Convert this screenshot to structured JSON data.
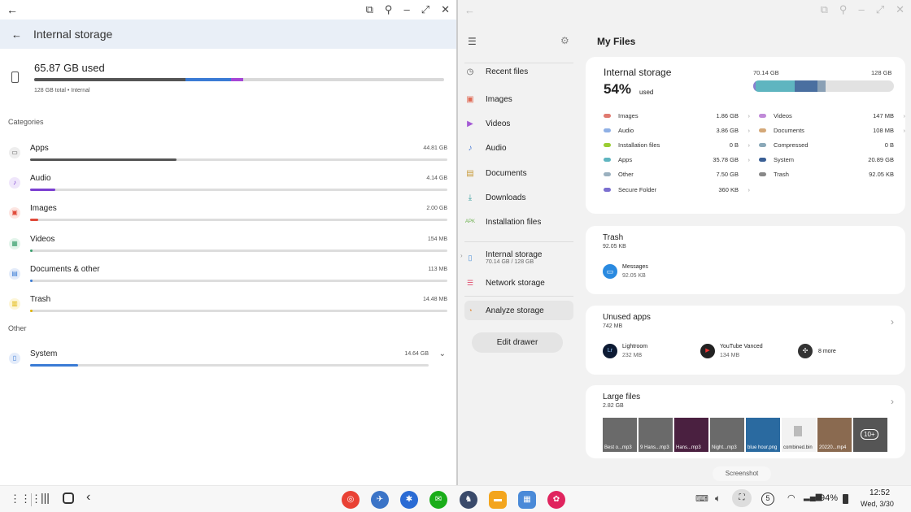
{
  "left": {
    "header_title": "Internal storage",
    "used": "65.87 GB used",
    "total": "128 GB total • Internal",
    "categories_label": "Categories",
    "other_label": "Other",
    "categories": [
      {
        "name": "Apps",
        "size": "44.81 GB",
        "fraction": 0.35,
        "color": "#555555"
      },
      {
        "name": "Audio",
        "size": "4.14 GB",
        "fraction": 0.06,
        "color": "#7b3fd1"
      },
      {
        "name": "Images",
        "size": "2.00 GB",
        "fraction": 0.02,
        "color": "#e04a3a"
      },
      {
        "name": "Videos",
        "size": "154 MB",
        "fraction": 0.004,
        "color": "#3aa06e"
      },
      {
        "name": "Documents & other",
        "size": "113 MB",
        "fraction": 0.003,
        "color": "#3a7bd5"
      },
      {
        "name": "Trash",
        "size": "14.48 MB",
        "fraction": 0.002,
        "color": "#e0b400"
      }
    ],
    "system": {
      "name": "System",
      "size": "14.64 GB",
      "fraction": 0.12,
      "color": "#3a7bd5"
    }
  },
  "drawer": {
    "items": [
      {
        "label": "Recent files",
        "icon": "clock-icon",
        "glyph": "◷",
        "color": "#555"
      },
      {
        "label": "Images",
        "icon": "image-icon",
        "glyph": "▣",
        "color": "#e06a55"
      },
      {
        "label": "Videos",
        "icon": "video-icon",
        "glyph": "▶",
        "color": "#a45ad5"
      },
      {
        "label": "Audio",
        "icon": "music-icon",
        "glyph": "♪",
        "color": "#4a7bd5"
      },
      {
        "label": "Documents",
        "icon": "document-icon",
        "glyph": "▤",
        "color": "#c89a3a"
      },
      {
        "label": "Downloads",
        "icon": "download-icon",
        "glyph": "⤓",
        "color": "#3aa0a0"
      },
      {
        "label": "Installation files",
        "icon": "apk-icon",
        "glyph": "APK",
        "color": "#6ab04c"
      }
    ],
    "storage_label": "Internal storage",
    "storage_sub": "70.14 GB / 128 GB",
    "network_label": "Network storage",
    "analyze_label": "Analyze storage",
    "edit_label": "Edit drawer"
  },
  "myfiles": {
    "title": "My Files",
    "storage_title": "Internal storage",
    "percent": "54%",
    "used_word": "used",
    "used_gb": "70.14 GB",
    "total_gb": "128 GB",
    "bar_segments": [
      {
        "fraction": 0.015,
        "color": "#8a7fd0"
      },
      {
        "fraction": 0.28,
        "color": "#5fb5c0"
      },
      {
        "fraction": 0.16,
        "color": "#4a6fa0"
      },
      {
        "fraction": 0.06,
        "color": "#8aa0b5"
      }
    ],
    "legend_left": [
      {
        "name": "Images",
        "value": "1.86 GB",
        "color": "#e07a70",
        "chev": true
      },
      {
        "name": "Audio",
        "value": "3.86 GB",
        "color": "#8fb0e5",
        "chev": true
      },
      {
        "name": "Installation files",
        "value": "0 B",
        "color": "#9acd32",
        "chev": true
      },
      {
        "name": "Apps",
        "value": "35.78 GB",
        "color": "#5fb5c0",
        "chev": true
      },
      {
        "name": "Other",
        "value": "7.50 GB",
        "color": "#9ab0bf",
        "chev": false
      },
      {
        "name": "Secure Folder",
        "value": "360 KB",
        "color": "#7b6fd0",
        "chev": true
      }
    ],
    "legend_right": [
      {
        "name": "Videos",
        "value": "147 MB",
        "color": "#c08ad8",
        "chev": true
      },
      {
        "name": "Documents",
        "value": "108 MB",
        "color": "#d4a878",
        "chev": true
      },
      {
        "name": "Compressed",
        "value": "0 B",
        "color": "#8aa8b8",
        "chev": false
      },
      {
        "name": "System",
        "value": "20.89 GB",
        "color": "#3a5f95",
        "chev": false
      },
      {
        "name": "Trash",
        "value": "92.05 KB",
        "color": "#888888",
        "chev": false
      }
    ],
    "trash": {
      "title": "Trash",
      "size": "92.05 KB",
      "item_name": "Messages",
      "item_size": "92.05 KB"
    },
    "unused": {
      "title": "Unused apps",
      "size": "742 MB",
      "apps": [
        {
          "name": "Lightroom",
          "size": "232 MB",
          "glyph": "Lr"
        },
        {
          "name": "YouTube Vanced",
          "size": "134 MB",
          "glyph": "▶"
        }
      ],
      "more": "8 more"
    },
    "large": {
      "title": "Large files",
      "size": "2.82 GB",
      "files": [
        "Best o...mp3",
        "9 Hans...mp3",
        "Hans...mp3",
        "Night...mp3",
        "blue hour.png",
        "combined.bin",
        "20220...mp4"
      ],
      "more": "10+"
    },
    "tooltip": "Screenshot"
  },
  "taskbar": {
    "battery": "94%",
    "time": "12:52",
    "date": "Wed, 3/30",
    "badge": "5"
  }
}
